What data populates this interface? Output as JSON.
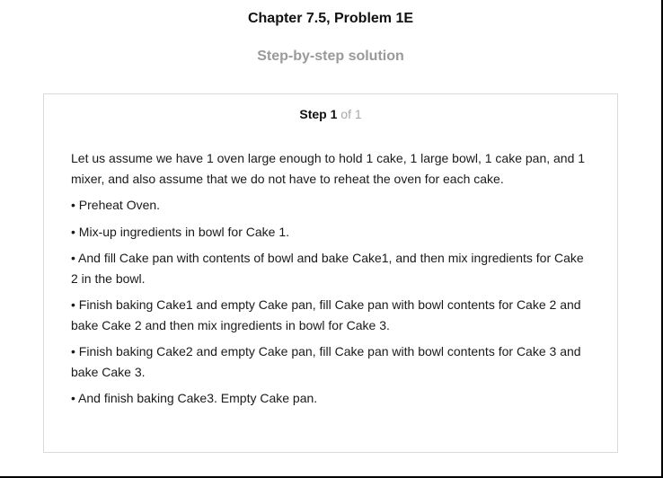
{
  "header": {
    "chapter_title": "Chapter 7.5, Problem 1E",
    "subtitle": "Step-by-step solution"
  },
  "step": {
    "label": "Step",
    "number": "1",
    "of_text": "of 1"
  },
  "solution": {
    "paragraphs": [
      "Let us assume we have 1 oven large enough to hold 1 cake, 1 large bowl, 1 cake pan, and 1 mixer, and also assume that we do not have to reheat the oven for each cake.",
      "• Preheat Oven.",
      "• Mix-up ingredients in bowl for Cake 1.",
      "• And fill Cake pan with contents of bowl and bake Cake1, and then mix ingredients for Cake 2 in the bowl.",
      "• Finish baking Cake1 and empty Cake pan, fill Cake pan with bowl contents for Cake 2 and bake Cake 2 and then mix ingredients in bowl for Cake 3.",
      "• Finish baking Cake2 and empty Cake pan, fill Cake pan with bowl contents for Cake 3 and bake Cake 3.",
      "• And finish baking Cake3. Empty Cake pan."
    ]
  }
}
